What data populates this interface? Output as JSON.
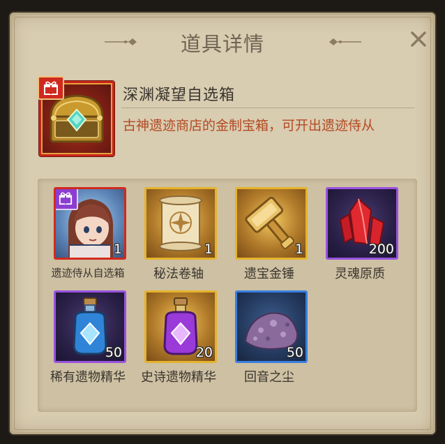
{
  "dialog": {
    "title": "道具详情",
    "close_label": "×"
  },
  "item": {
    "name": "深渊凝望自选箱",
    "description": "古神遗迹商店的金制宝箱，可开出遗迹侍从",
    "icon": "golden-chest-icon",
    "badge_icon": "gift-icon"
  },
  "rewards": [
    {
      "label": "遗迹侍从自选箱",
      "count": "1",
      "icon": "companion-portrait-icon",
      "frame": "red"
    },
    {
      "label": "秘法卷轴",
      "count": "1",
      "icon": "scroll-icon",
      "frame": "gold"
    },
    {
      "label": "遗宝金锤",
      "count": "1",
      "icon": "golden-hammer-icon",
      "frame": "gold"
    },
    {
      "label": "灵魂原质",
      "count": "200",
      "icon": "red-crystal-icon",
      "frame": "purple"
    },
    {
      "label": "稀有遗物精华",
      "count": "50",
      "icon": "blue-potion-icon",
      "frame": "purple"
    },
    {
      "label": "史诗遗物精华",
      "count": "20",
      "icon": "purple-potion-icon",
      "frame": "gold"
    },
    {
      "label": "回音之尘",
      "count": "50",
      "icon": "purple-dust-icon",
      "frame": "blue"
    }
  ],
  "colors": {
    "parchment": "#d8ccb1",
    "description_text": "#b44a22",
    "frame_red": "#d12a1d",
    "frame_gold": "#e5b32c",
    "frame_purple": "#9a52de",
    "frame_blue": "#3a7fe0"
  }
}
